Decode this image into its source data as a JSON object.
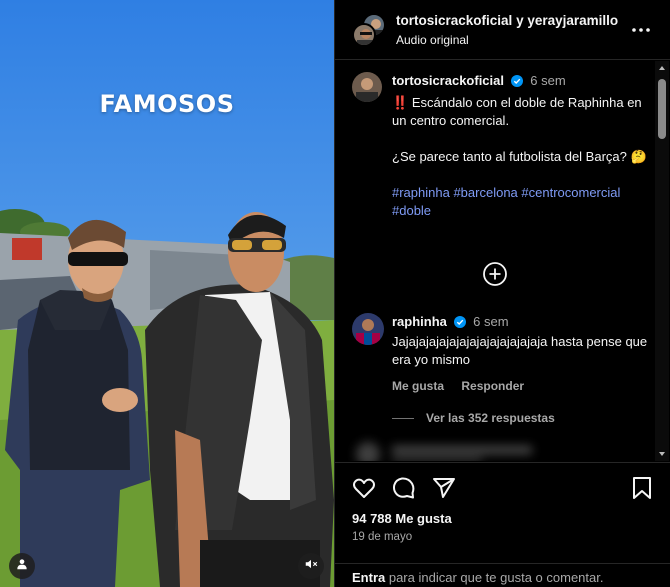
{
  "media": {
    "overlay_text": "FAMOSOS"
  },
  "header": {
    "user1": "tortosicrackoficial",
    "connector": "y",
    "user2": "yerayjaramillo",
    "audio": "Audio original"
  },
  "caption": {
    "username": "tortosicrackoficial",
    "time": "6 sem",
    "mark": "‼️",
    "line1": "Escándalo con el doble de Raphinha en un centro comercial.",
    "line2": "¿Se parece tanto al futbolista del Barça? 🤔",
    "hashtags": [
      "#raphinha",
      "#barcelona",
      "#centrocomercial",
      "#doble"
    ]
  },
  "comment": {
    "username": "raphinha",
    "time": "6 sem",
    "text": "Jajajajajajajajajajajajajajaja hasta pense que era yo mismo",
    "like_label": "Me gusta",
    "reply_label": "Responder",
    "view_replies": "Ver las 352 respuestas"
  },
  "footer": {
    "likes": "94 788 Me gusta",
    "date": "19 de mayo",
    "login_link": "Entra",
    "login_rest": " para indicar que te gusta o comentar."
  },
  "colors": {
    "background": "#000000",
    "hashtag": "#7f9bf5",
    "secondary_text": "#a8a8a8",
    "verified": "#0095f6"
  },
  "icons": [
    "more-icon",
    "verified-icon",
    "plus-circle-icon",
    "heart-icon",
    "comment-icon",
    "share-icon",
    "bookmark-icon",
    "person-tag-icon",
    "muted-speaker-icon"
  ]
}
